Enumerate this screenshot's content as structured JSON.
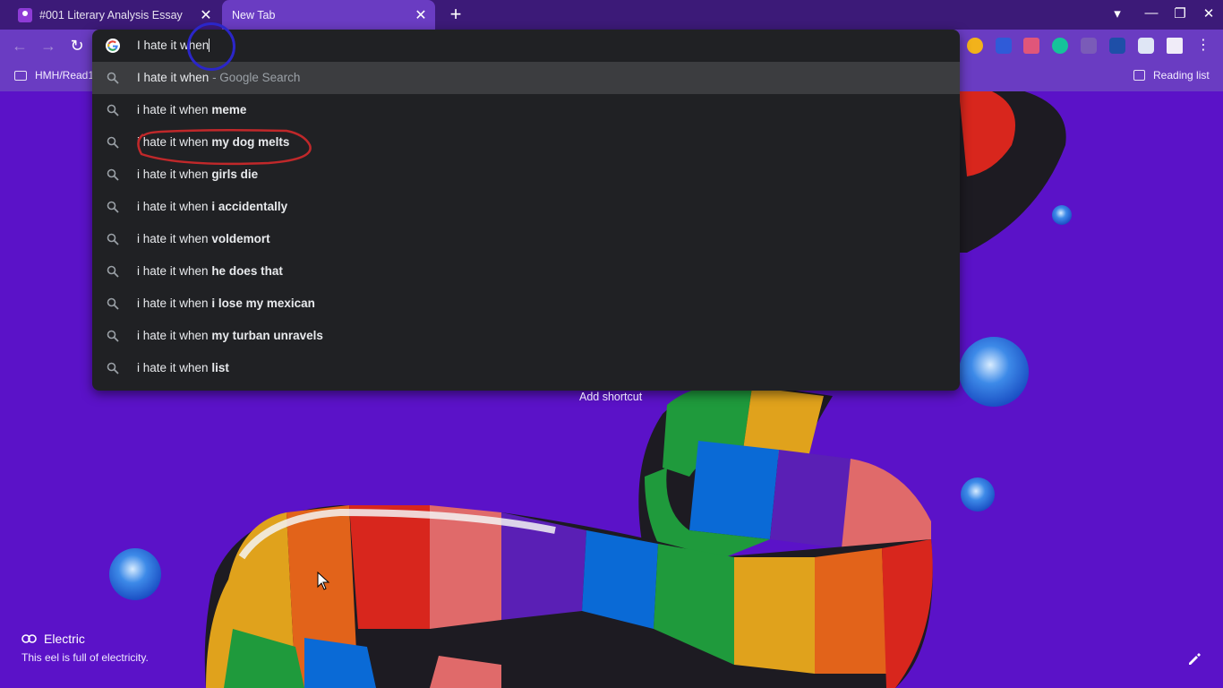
{
  "tabs": [
    {
      "title": "#001 Literary Analysis Essay",
      "close": "✕"
    },
    {
      "title": "New Tab",
      "close": "✕"
    }
  ],
  "new_tab_symbol": "+",
  "window_controls": {
    "profile": "▾",
    "minimize": "—",
    "restore": "❐",
    "close": "✕"
  },
  "nav": {
    "back": "←",
    "forward": "→",
    "reload": "↻"
  },
  "bookmarks": [
    {
      "label": "HMH/Read1"
    }
  ],
  "reading_list": "Reading list",
  "omnibox": {
    "value": "I hate it when",
    "suggestions": [
      {
        "prefix": "I hate it when",
        "suffix": " - Google Search",
        "type": "search-what-you-typed"
      },
      {
        "prefix": "i hate it when ",
        "bold": "meme"
      },
      {
        "prefix": "i hate it when ",
        "bold": "my dog melts"
      },
      {
        "prefix": "i hate it when ",
        "bold": "girls die"
      },
      {
        "prefix": "i hate it when ",
        "bold": "i accidentally"
      },
      {
        "prefix": "i hate it when ",
        "bold": "voldemort"
      },
      {
        "prefix": "i hate it when ",
        "bold": "he does that"
      },
      {
        "prefix": "i hate it when ",
        "bold": "i lose my mexican"
      },
      {
        "prefix": "i hate it when ",
        "bold": "my turban unravels"
      },
      {
        "prefix": "i hate it when ",
        "bold": "list"
      }
    ]
  },
  "add_shortcut": "Add shortcut",
  "attribution": {
    "title": "Electric",
    "subtitle": "This eel is full of electricity."
  },
  "colors": {
    "tab_strip": "#3c1a78",
    "toolbar": "#6a3cc2",
    "background": "#5b12c8",
    "dropdown": "#202124",
    "annotation_red": "#c0282a",
    "annotation_blue": "#2b26c9"
  }
}
